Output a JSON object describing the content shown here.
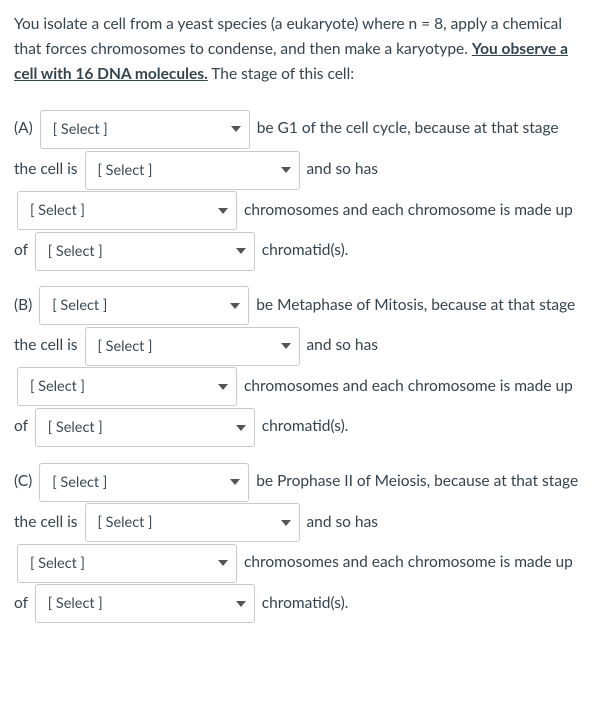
{
  "intro": {
    "pre": "You isolate a cell from a yeast species (a eukaryote) where n = 8, apply a chemical that forces chromosomes to condense, and then make a karyotype.  ",
    "emph": "You observe a cell with 16 DNA molecules.",
    "post": "  The stage of this cell:"
  },
  "select_placeholder": "[ Select ]",
  "parts": {
    "A": {
      "label": "(A)",
      "t1": " be G1 of the cell cycle, because at that stage the cell is ",
      "t2": " and so has ",
      "t3": " chromosomes and each chromosome is made up of ",
      "t4": " chromatid(s)."
    },
    "B": {
      "label": "(B)",
      "t1": " be Metaphase of Mitosis, because at that stage the cell is ",
      "t2": " and so has ",
      "t3": " chromosomes and each chromosome is made up of ",
      "t4": " chromatid(s)."
    },
    "C": {
      "label": "(C)",
      "t1": " be Prophase II of Meiosis, because at that stage the cell is ",
      "t2": " and so has ",
      "t3": " chromosomes and each chromosome is made up of ",
      "t4": " chromatid(s)."
    }
  }
}
